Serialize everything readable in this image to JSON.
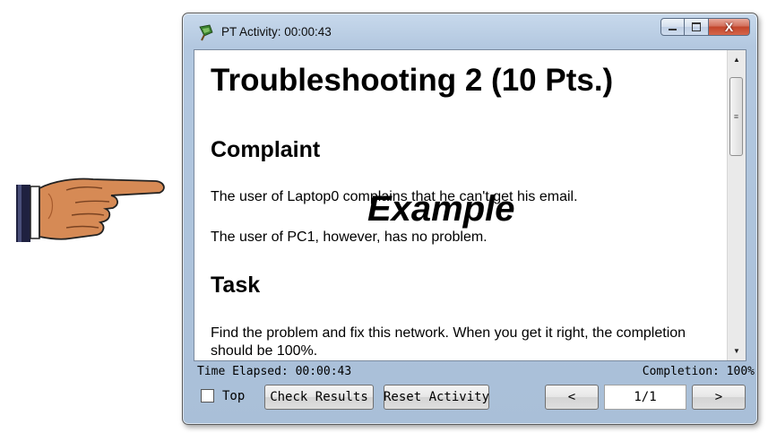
{
  "window": {
    "title": "PT Activity: 00:00:43",
    "controls": {
      "minimize_icon": "minimize-icon",
      "maximize_icon": "maximize-icon",
      "close_label": "X"
    }
  },
  "document": {
    "title": "Troubleshooting 2 (10 Pts.)",
    "sections": [
      {
        "heading": "Complaint",
        "paragraphs": [
          "The user of Laptop0 complains that he can't get his email.",
          "The user of PC1, however, has no problem."
        ]
      },
      {
        "heading": "Task",
        "paragraphs": [
          "Find the problem and fix this network. When you get it right, the completion should be 100%."
        ]
      }
    ],
    "watermark": "Example"
  },
  "status": {
    "time_elapsed": "Time Elapsed: 00:00:43",
    "completion": "Completion: 100%"
  },
  "footer": {
    "top_checkbox_label": "Top",
    "top_checked": false,
    "check_results_label": "Check Results",
    "reset_activity_label": "Reset Activity",
    "prev_label": "<",
    "page_indicator": "1/1",
    "next_label": ">"
  },
  "decorations": {
    "pointer": "pointing-hand-icon"
  }
}
